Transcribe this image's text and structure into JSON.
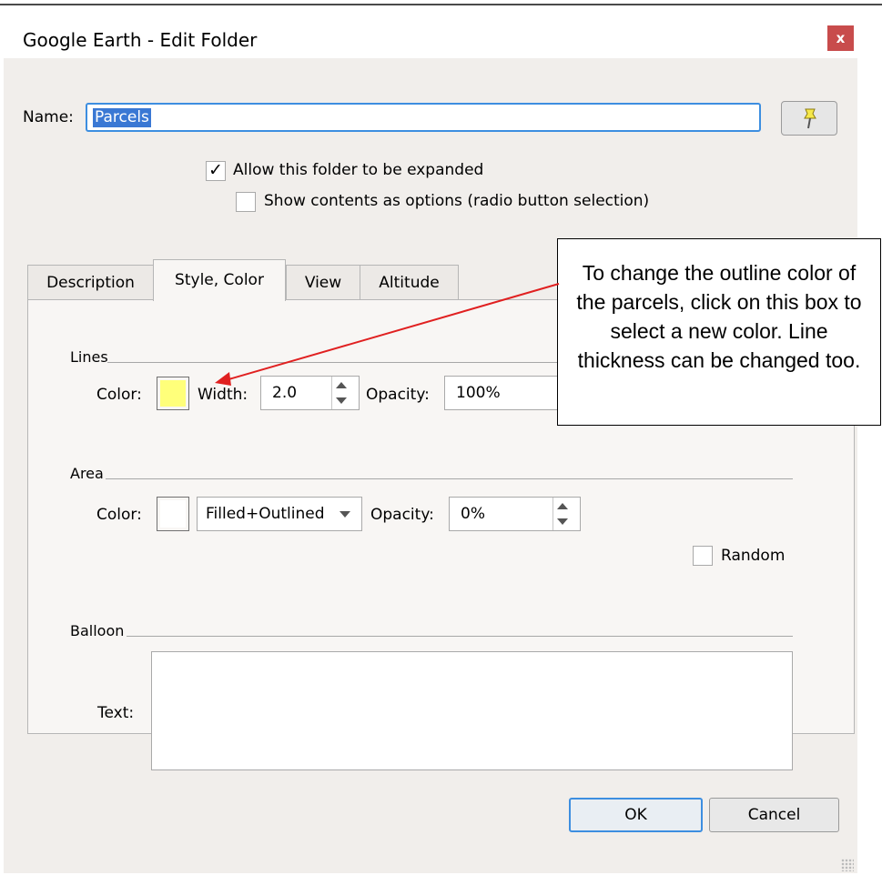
{
  "window": {
    "title": "Google Earth - Edit Folder",
    "close_label": "x"
  },
  "name": {
    "label": "Name:",
    "value": "Parcels",
    "pin_icon": "pushpin-icon"
  },
  "options": {
    "allow_expand": {
      "label": "Allow this folder to be expanded",
      "checked": true,
      "mark": "✓"
    },
    "radio_contents": {
      "label": "Show contents as options (radio button selection)",
      "checked": false
    }
  },
  "tabs": [
    {
      "label": "Description",
      "active": false
    },
    {
      "label": "Style, Color",
      "active": true
    },
    {
      "label": "View",
      "active": false
    },
    {
      "label": "Altitude",
      "active": false
    }
  ],
  "lines": {
    "heading": "Lines",
    "color_label": "Color:",
    "swatch_color": "#ffff7a",
    "width_label": "Width:",
    "width_value": "2.0",
    "opacity_label": "Opacity:",
    "opacity_value": "100%"
  },
  "area": {
    "heading": "Area",
    "color_label": "Color:",
    "swatch_color": "#ffffff",
    "mode_value": "Filled+Outlined",
    "opacity_label": "Opacity:",
    "opacity_value": "0%",
    "random_label": "Random",
    "random_checked": false
  },
  "balloon": {
    "heading": "Balloon",
    "text_label": "Text:",
    "text_value": ""
  },
  "buttons": {
    "ok": "OK",
    "cancel": "Cancel"
  },
  "annotation": {
    "text": "To change the outline color of the parcels, click on this box to select a new color. Line thickness can be changed too.",
    "arrow_color": "#e02020"
  }
}
